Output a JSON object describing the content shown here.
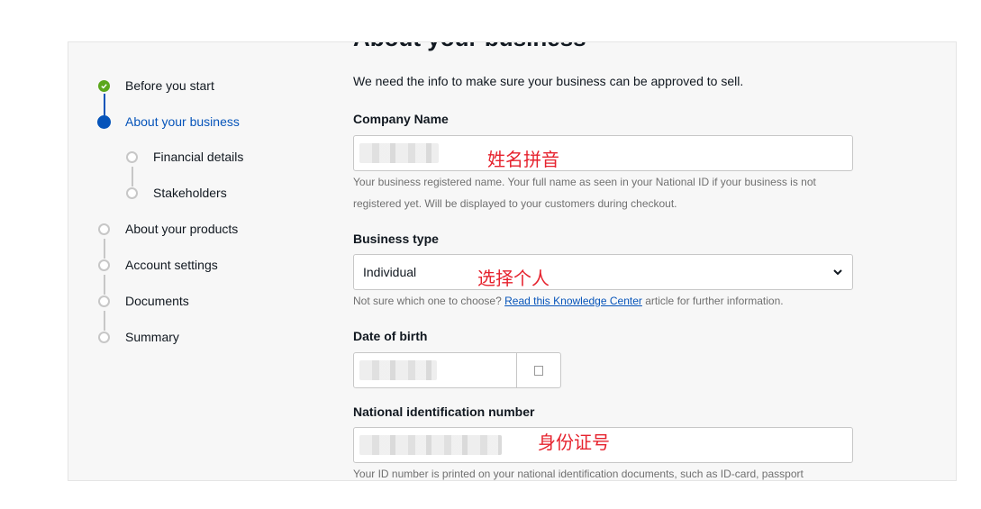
{
  "page": {
    "heading": "About your business"
  },
  "steps": [
    {
      "label": "Before you start",
      "state": "done"
    },
    {
      "label": "About your business",
      "state": "active"
    },
    {
      "label": "Financial details",
      "state": "todo"
    },
    {
      "label": "Stakeholders",
      "state": "todo"
    },
    {
      "label": "About your products",
      "state": "todo"
    },
    {
      "label": "Account settings",
      "state": "todo"
    },
    {
      "label": "Documents",
      "state": "todo"
    },
    {
      "label": "Summary",
      "state": "todo"
    }
  ],
  "form": {
    "intro": "We need the info to make sure your business can be approved to sell.",
    "company_name": {
      "label": "Company Name",
      "annotation": "姓名拼音",
      "help": "Your business registered name. Your full name as seen in your National ID if your business is not registered yet. Will be displayed to your customers during checkout."
    },
    "business_type": {
      "label": "Business type",
      "value": "Individual",
      "annotation": "选择个人",
      "help_prefix": "Not sure which one to choose?",
      "help_link": "Read this Knowledge Center",
      "help_suffix": "article for further information."
    },
    "date_of_birth": {
      "label": "Date of birth"
    },
    "national_id": {
      "label": "National identification number",
      "annotation": "身份证号",
      "help": "Your ID number is printed on your national identification documents, such as ID-card, passport"
    }
  },
  "colors": {
    "accent": "#0654ba",
    "done": "#5ba71b",
    "annotation": "#e6232e"
  },
  "icons": {
    "done": "check-icon",
    "select": "chevron-down-icon",
    "calendar": "calendar-icon"
  }
}
